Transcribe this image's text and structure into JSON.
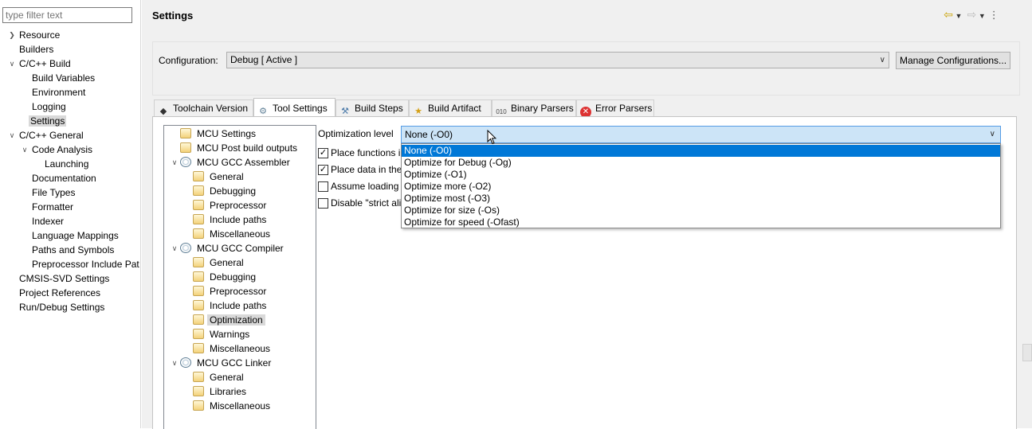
{
  "filter": {
    "placeholder": "type filter text"
  },
  "nav": {
    "items": [
      {
        "label": "Resource"
      },
      {
        "label": "Builders"
      },
      {
        "label": "C/C++ Build"
      },
      {
        "label": "Build Variables"
      },
      {
        "label": "Environment"
      },
      {
        "label": "Logging"
      },
      {
        "label": "Settings"
      },
      {
        "label": "C/C++ General"
      },
      {
        "label": "Code Analysis"
      },
      {
        "label": "Launching"
      },
      {
        "label": "Documentation"
      },
      {
        "label": "File Types"
      },
      {
        "label": "Formatter"
      },
      {
        "label": "Indexer"
      },
      {
        "label": "Language Mappings"
      },
      {
        "label": "Paths and Symbols"
      },
      {
        "label": "Preprocessor Include Pat"
      },
      {
        "label": "CMSIS-SVD Settings"
      },
      {
        "label": "Project References"
      },
      {
        "label": "Run/Debug Settings"
      }
    ]
  },
  "page": {
    "title": "Settings"
  },
  "config": {
    "label": "Configuration:",
    "value": "Debug  [ Active ]",
    "manage_label": "Manage Configurations..."
  },
  "tabs": [
    {
      "label": "Toolchain Version"
    },
    {
      "label": "Tool Settings"
    },
    {
      "label": "Build Steps"
    },
    {
      "label": "Build Artifact"
    },
    {
      "label": "Binary Parsers"
    },
    {
      "label": "Error Parsers"
    }
  ],
  "tree": {
    "items": [
      {
        "label": "MCU Settings"
      },
      {
        "label": "MCU Post build outputs"
      },
      {
        "label": "MCU GCC Assembler"
      },
      {
        "label": "General"
      },
      {
        "label": "Debugging"
      },
      {
        "label": "Preprocessor"
      },
      {
        "label": "Include paths"
      },
      {
        "label": "Miscellaneous"
      },
      {
        "label": "MCU GCC Compiler"
      },
      {
        "label": "General"
      },
      {
        "label": "Debugging"
      },
      {
        "label": "Preprocessor"
      },
      {
        "label": "Include paths"
      },
      {
        "label": "Optimization"
      },
      {
        "label": "Warnings"
      },
      {
        "label": "Miscellaneous"
      },
      {
        "label": "MCU GCC Linker"
      },
      {
        "label": "General"
      },
      {
        "label": "Libraries"
      },
      {
        "label": "Miscellaneous"
      }
    ]
  },
  "optimization": {
    "label": "Optimization level",
    "value": "None (-O0)",
    "options": [
      "None (-O0)",
      "Optimize for Debug (-Og)",
      "Optimize (-O1)",
      "Optimize more (-O2)",
      "Optimize most (-O3)",
      "Optimize for size (-Os)",
      "Optimize for speed (-Ofast)"
    ]
  },
  "checks": [
    {
      "label": "Place functions i",
      "checked": true
    },
    {
      "label": "Place data in the",
      "checked": true
    },
    {
      "label": "Assume loading",
      "checked": false
    },
    {
      "label": "Disable \"strict ali",
      "checked": false
    }
  ],
  "colors": {
    "accent": "#0078d7",
    "selection": "#d9d9d9",
    "combo_focus": "#cce4f7"
  }
}
